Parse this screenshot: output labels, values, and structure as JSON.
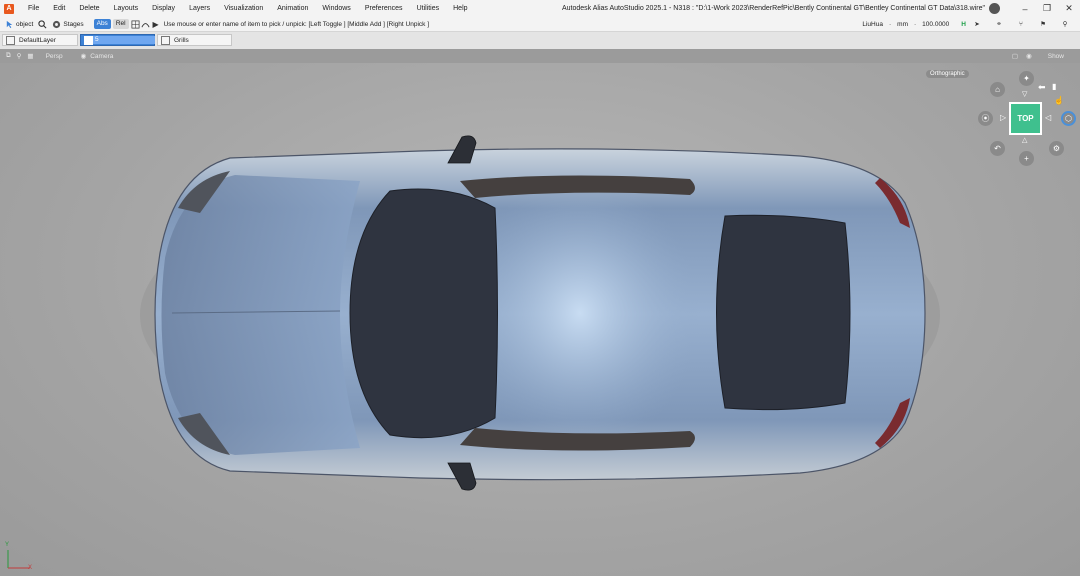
{
  "menu": {
    "app_icon_label": "A",
    "items": [
      "File",
      "Edit",
      "Delete",
      "Layouts",
      "Display",
      "Layers",
      "Visualization",
      "Animation",
      "Windows",
      "Preferences",
      "Utilities",
      "Help"
    ]
  },
  "window": {
    "title": "Autodesk Alias AutoStudio 2025.1   - N318 : \"D:\\1-Work 2023\\RenderRefPic\\Bently Continental GT\\Bentley Continental GT Data\\318.wire\""
  },
  "toolbar": {
    "pick_mode": "object",
    "stages": "Stages",
    "abs": "Abs",
    "rel": "Rel",
    "prompt": "Use mouse or enter name of item to pick / unpick: [Left Toggle ] [Middle Add ] [Right Unpick ]",
    "user": "LiuHua",
    "unit": "mm",
    "tolerance": "100.0000",
    "h_label": "H"
  },
  "layers": {
    "default": "DefaultLayer",
    "active_value": "5",
    "grills": "Grills"
  },
  "viewbar": {
    "persp": "Persp",
    "camera": "Camera",
    "show": "Show"
  },
  "viewport": {
    "projection": "Orthographic",
    "cube_face": "TOP",
    "axis_y": "Y",
    "axis_x": "X",
    "colors": {
      "body": "#8aa3c4",
      "glass": "#2f3440",
      "cube": "#3fc08e"
    }
  }
}
